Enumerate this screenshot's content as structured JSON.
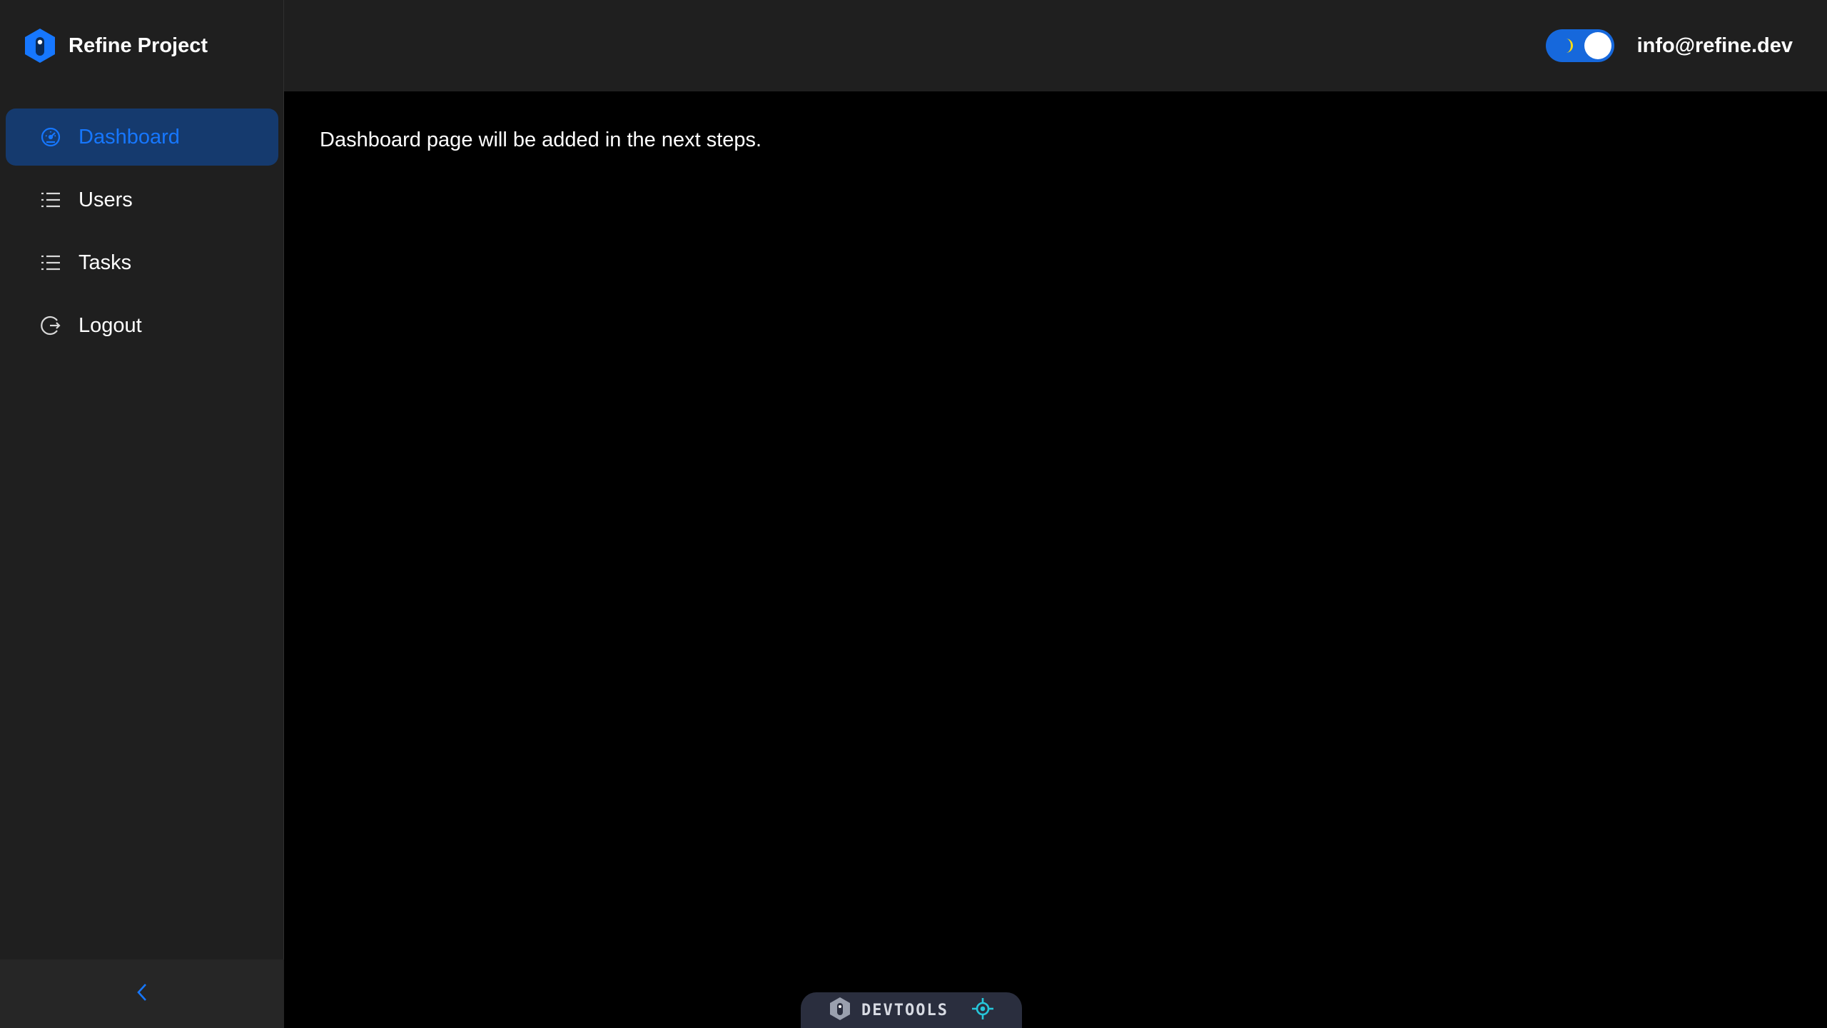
{
  "brand": {
    "title": "Refine Project",
    "logo_icon": "refine-logo-icon",
    "accent": "#1677ff"
  },
  "sidebar": {
    "items": [
      {
        "label": "Dashboard",
        "icon": "dashboard-icon",
        "active": true
      },
      {
        "label": "Users",
        "icon": "list-icon",
        "active": false
      },
      {
        "label": "Tasks",
        "icon": "list-icon",
        "active": false
      },
      {
        "label": "Logout",
        "icon": "logout-icon",
        "active": false
      }
    ],
    "collapse_icon": "chevron-left-icon"
  },
  "header": {
    "theme_toggle": {
      "state": "dark",
      "icon": "moon-icon"
    },
    "user_email": "info@refine.dev"
  },
  "main": {
    "message": "Dashboard page will be added in the next steps."
  },
  "devtools": {
    "label": "DEVTOOLS",
    "icons": [
      "refine-logo-icon",
      "crosshair-icon"
    ]
  },
  "colors": {
    "sidebar_bg": "#1f1f1f",
    "header_bg": "#1f1f1f",
    "content_bg": "#000000",
    "active_item_bg": "#153a6e",
    "active_item_text": "#1677ff",
    "toggle_bg": "#1668dc",
    "devtools_accent": "#26c6da"
  }
}
